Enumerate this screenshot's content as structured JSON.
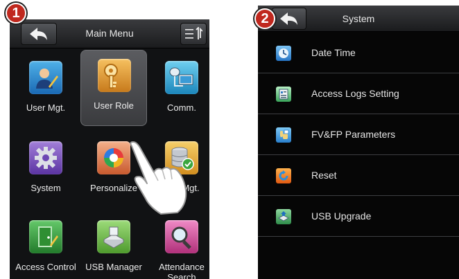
{
  "step_badges": [
    "1",
    "2"
  ],
  "main_menu": {
    "title": "Main Menu",
    "tiles": [
      {
        "label": "User Mgt.",
        "icon": "user-mgt-icon",
        "selected": false
      },
      {
        "label": "User Role",
        "icon": "key-icon",
        "selected": true
      },
      {
        "label": "Comm.",
        "icon": "network-icon",
        "selected": false
      },
      {
        "label": "System",
        "icon": "gear-icon",
        "selected": false
      },
      {
        "label": "Personalize",
        "icon": "color-wheel-icon",
        "selected": false
      },
      {
        "label": "Mgt.",
        "icon": "database-check-icon",
        "selected": false
      },
      {
        "label": "Access Control",
        "icon": "door-icon",
        "selected": false
      },
      {
        "label": "USB Manager",
        "icon": "usb-disk-icon",
        "selected": false
      },
      {
        "label": "Attendance Search",
        "icon": "magnifier-icon",
        "selected": false
      }
    ]
  },
  "system_menu": {
    "title": "System",
    "items": [
      {
        "label": "Date Time",
        "icon": "clock-icon"
      },
      {
        "label": "Access Logs Setting",
        "icon": "logs-icon"
      },
      {
        "label": "FV&FP Parameters",
        "icon": "finger-icon"
      },
      {
        "label": "Reset",
        "icon": "reset-icon"
      },
      {
        "label": "USB Upgrade",
        "icon": "usb-upgrade-icon"
      }
    ]
  },
  "colors": {
    "badge": "#c0281e",
    "screen_bg": "#111214",
    "header": "#2a2b2e",
    "text": "#ececec"
  }
}
